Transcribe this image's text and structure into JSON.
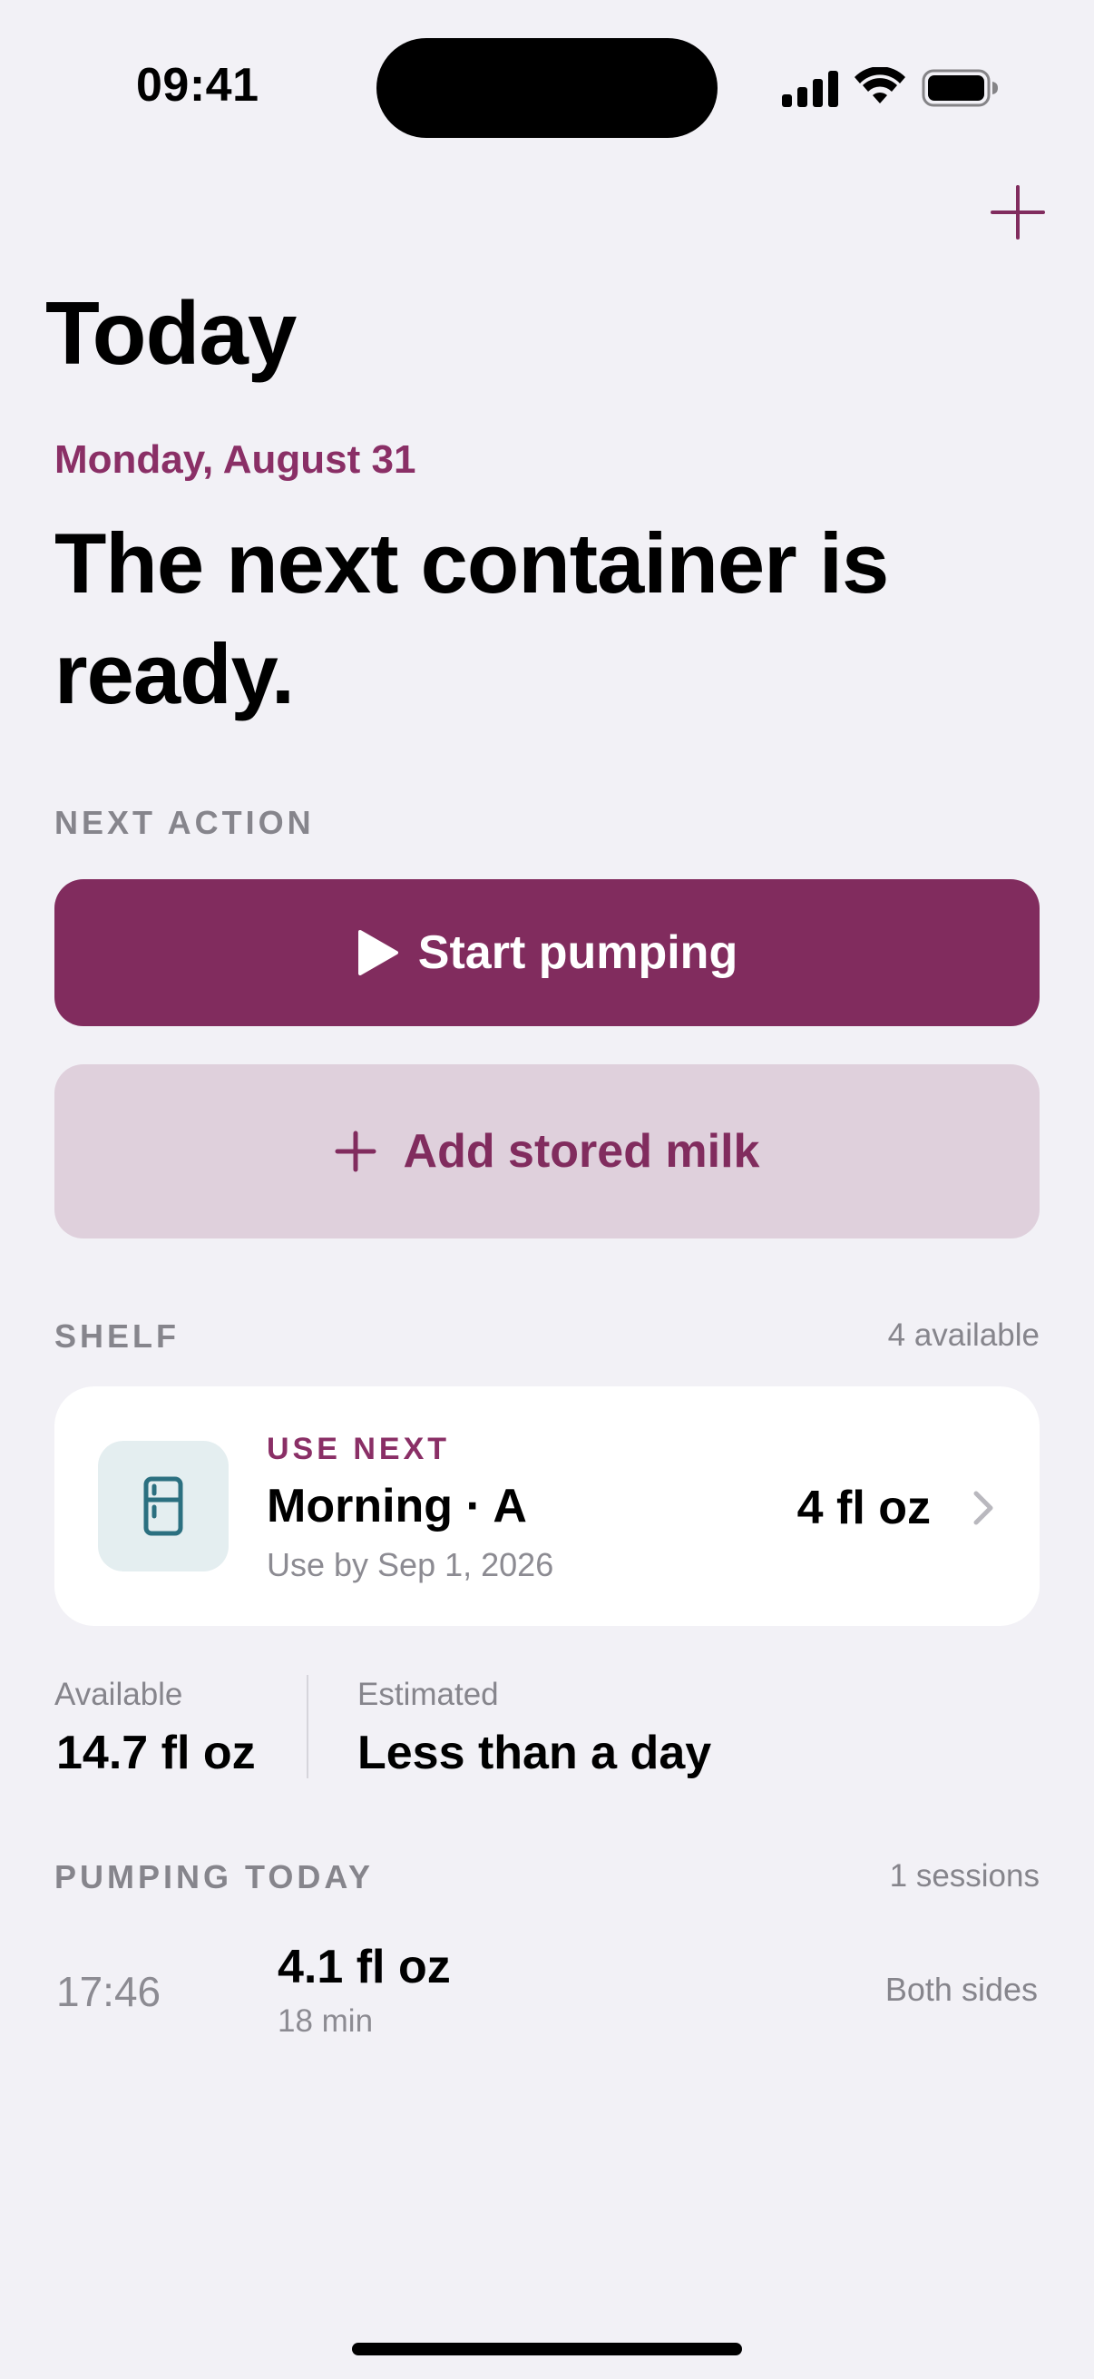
{
  "status_bar": {
    "time": "09:41"
  },
  "header": {
    "title": "Today"
  },
  "hero": {
    "date": "Monday, August 31",
    "headline": "The next container is ready."
  },
  "next_action": {
    "label": "NEXT ACTION",
    "primary_button": "Start pumping",
    "secondary_button": "Add stored milk"
  },
  "shelf": {
    "label": "SHELF",
    "count": "4 available",
    "card": {
      "tag": "USE NEXT",
      "name": "Morning · A",
      "use_by": "Use by Sep 1, 2026",
      "quantity": "4 fl oz",
      "icon": "fridge-icon"
    }
  },
  "stats": {
    "available_label": "Available",
    "available_value": "14.7 fl oz",
    "estimated_label": "Estimated",
    "estimated_value": "Less than a day"
  },
  "pumping_today": {
    "label": "PUMPING TODAY",
    "count": "1 sessions",
    "sessions": [
      {
        "time": "17:46",
        "amount": "4.1 fl oz",
        "duration": "18 min",
        "side": "Both sides"
      }
    ]
  },
  "colors": {
    "accent": "#812c5e",
    "accent_light": "#dfd0dc",
    "icon_teal": "#2b7080",
    "background": "#f2f1f6"
  }
}
